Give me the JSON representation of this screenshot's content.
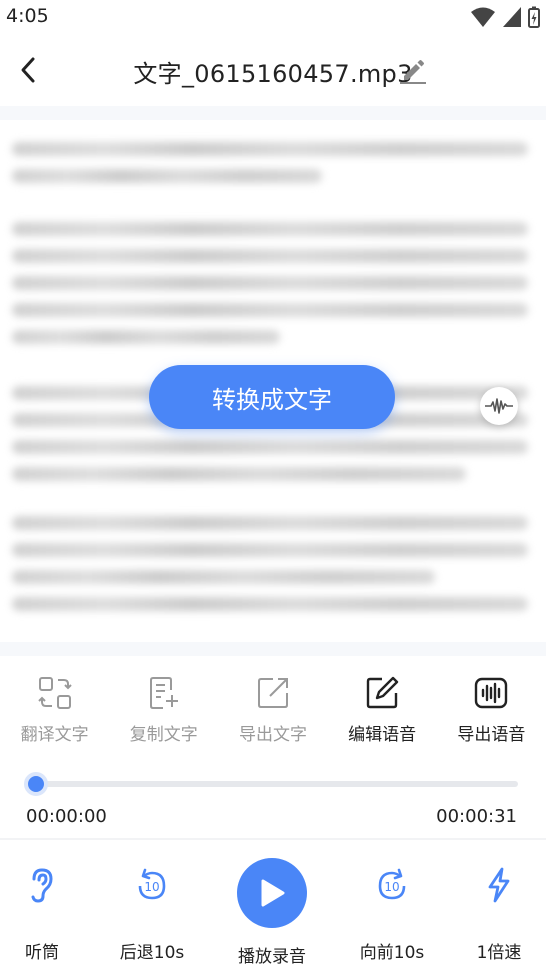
{
  "status_bar": {
    "time": "4:05"
  },
  "header": {
    "title": "文字_0615160457.mp3"
  },
  "content": {
    "convert_label": "转换成文字"
  },
  "tools": [
    {
      "label": "翻译文字",
      "icon": "translate-icon",
      "enabled": false
    },
    {
      "label": "复制文字",
      "icon": "copy-text-icon",
      "enabled": false
    },
    {
      "label": "导出文字",
      "icon": "export-text-icon",
      "enabled": false
    },
    {
      "label": "编辑语音",
      "icon": "edit-audio-icon",
      "enabled": true
    },
    {
      "label": "导出语音",
      "icon": "export-audio-icon",
      "enabled": true
    }
  ],
  "player": {
    "current_time": "00:00:00",
    "total_time": "00:00:31",
    "progress": 0.0
  },
  "controls": {
    "earpiece": "听筒",
    "rewind": "后退10s",
    "play": "播放录音",
    "forward": "向前10s",
    "speed": "1倍速"
  },
  "colors": {
    "accent": "#4a86f7",
    "disabled": "#9a9a9a",
    "text": "#222222"
  }
}
